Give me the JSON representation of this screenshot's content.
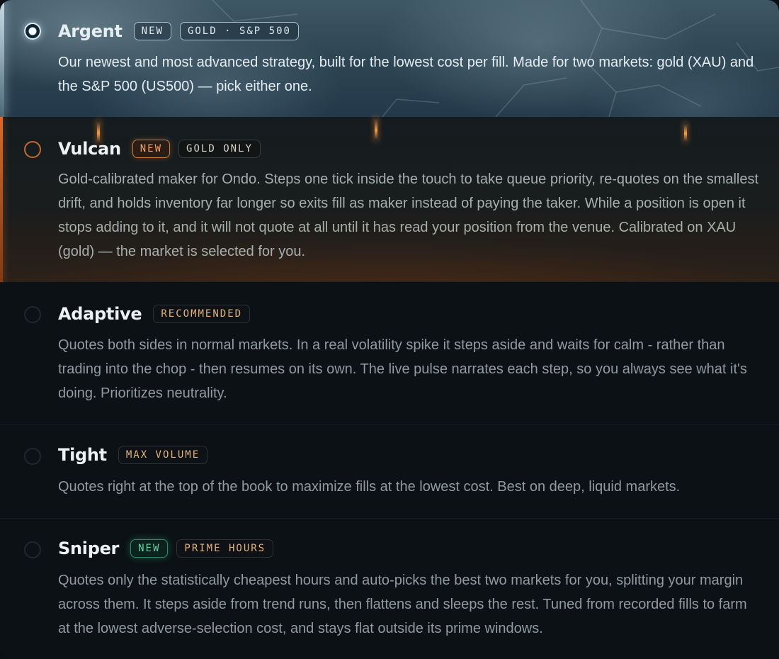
{
  "strategies": [
    {
      "id": "argent",
      "name": "Argent",
      "selected": true,
      "badges": [
        "NEW",
        "GOLD · S&P 500"
      ],
      "description": "Our newest and most advanced strategy, built for the lowest cost per fill. Made for two markets: gold (XAU) and the S&P 500 (US500) — pick either one."
    },
    {
      "id": "vulcan",
      "name": "Vulcan",
      "selected": false,
      "badges": [
        "NEW",
        "GOLD ONLY"
      ],
      "description": "Gold-calibrated maker for Ondo. Steps one tick inside the touch to take queue priority, re-quotes on the smallest drift, and holds inventory far longer so exits fill as maker instead of paying the taker. While a position is open it stops adding to it, and it will not quote at all until it has read your position from the venue. Calibrated on XAU (gold) — the market is selected for you."
    },
    {
      "id": "adaptive",
      "name": "Adaptive",
      "selected": false,
      "badges": [
        "RECOMMENDED"
      ],
      "description": "Quotes both sides in normal markets. In a real volatility spike it steps aside and waits for calm - rather than trading into the chop - then resumes on its own. The live pulse narrates each step, so you always see what it's doing. Prioritizes neutrality."
    },
    {
      "id": "tight",
      "name": "Tight",
      "selected": false,
      "badges": [
        "MAX VOLUME"
      ],
      "description": "Quotes right at the top of the book to maximize fills at the lowest cost. Best on deep, liquid markets."
    },
    {
      "id": "sniper",
      "name": "Sniper",
      "selected": false,
      "badges": [
        "NEW",
        "PRIME HOURS"
      ],
      "description": "Quotes only the statistically cheapest hours and auto-picks the best two markets for you, splitting your margin across them. It steps aside from trend runs, then flattens and sleeps the rest. Tuned from recorded fills to farm at the lowest adverse-selection cost, and stays flat outside its prime windows."
    }
  ],
  "colors": {
    "argent_accent": "#dfeaf0",
    "vulcan_accent": "#d07a3a",
    "new_green": "#58d8a8",
    "tag_amber": "#e0b27a",
    "description_text": "#8f9ba1"
  }
}
